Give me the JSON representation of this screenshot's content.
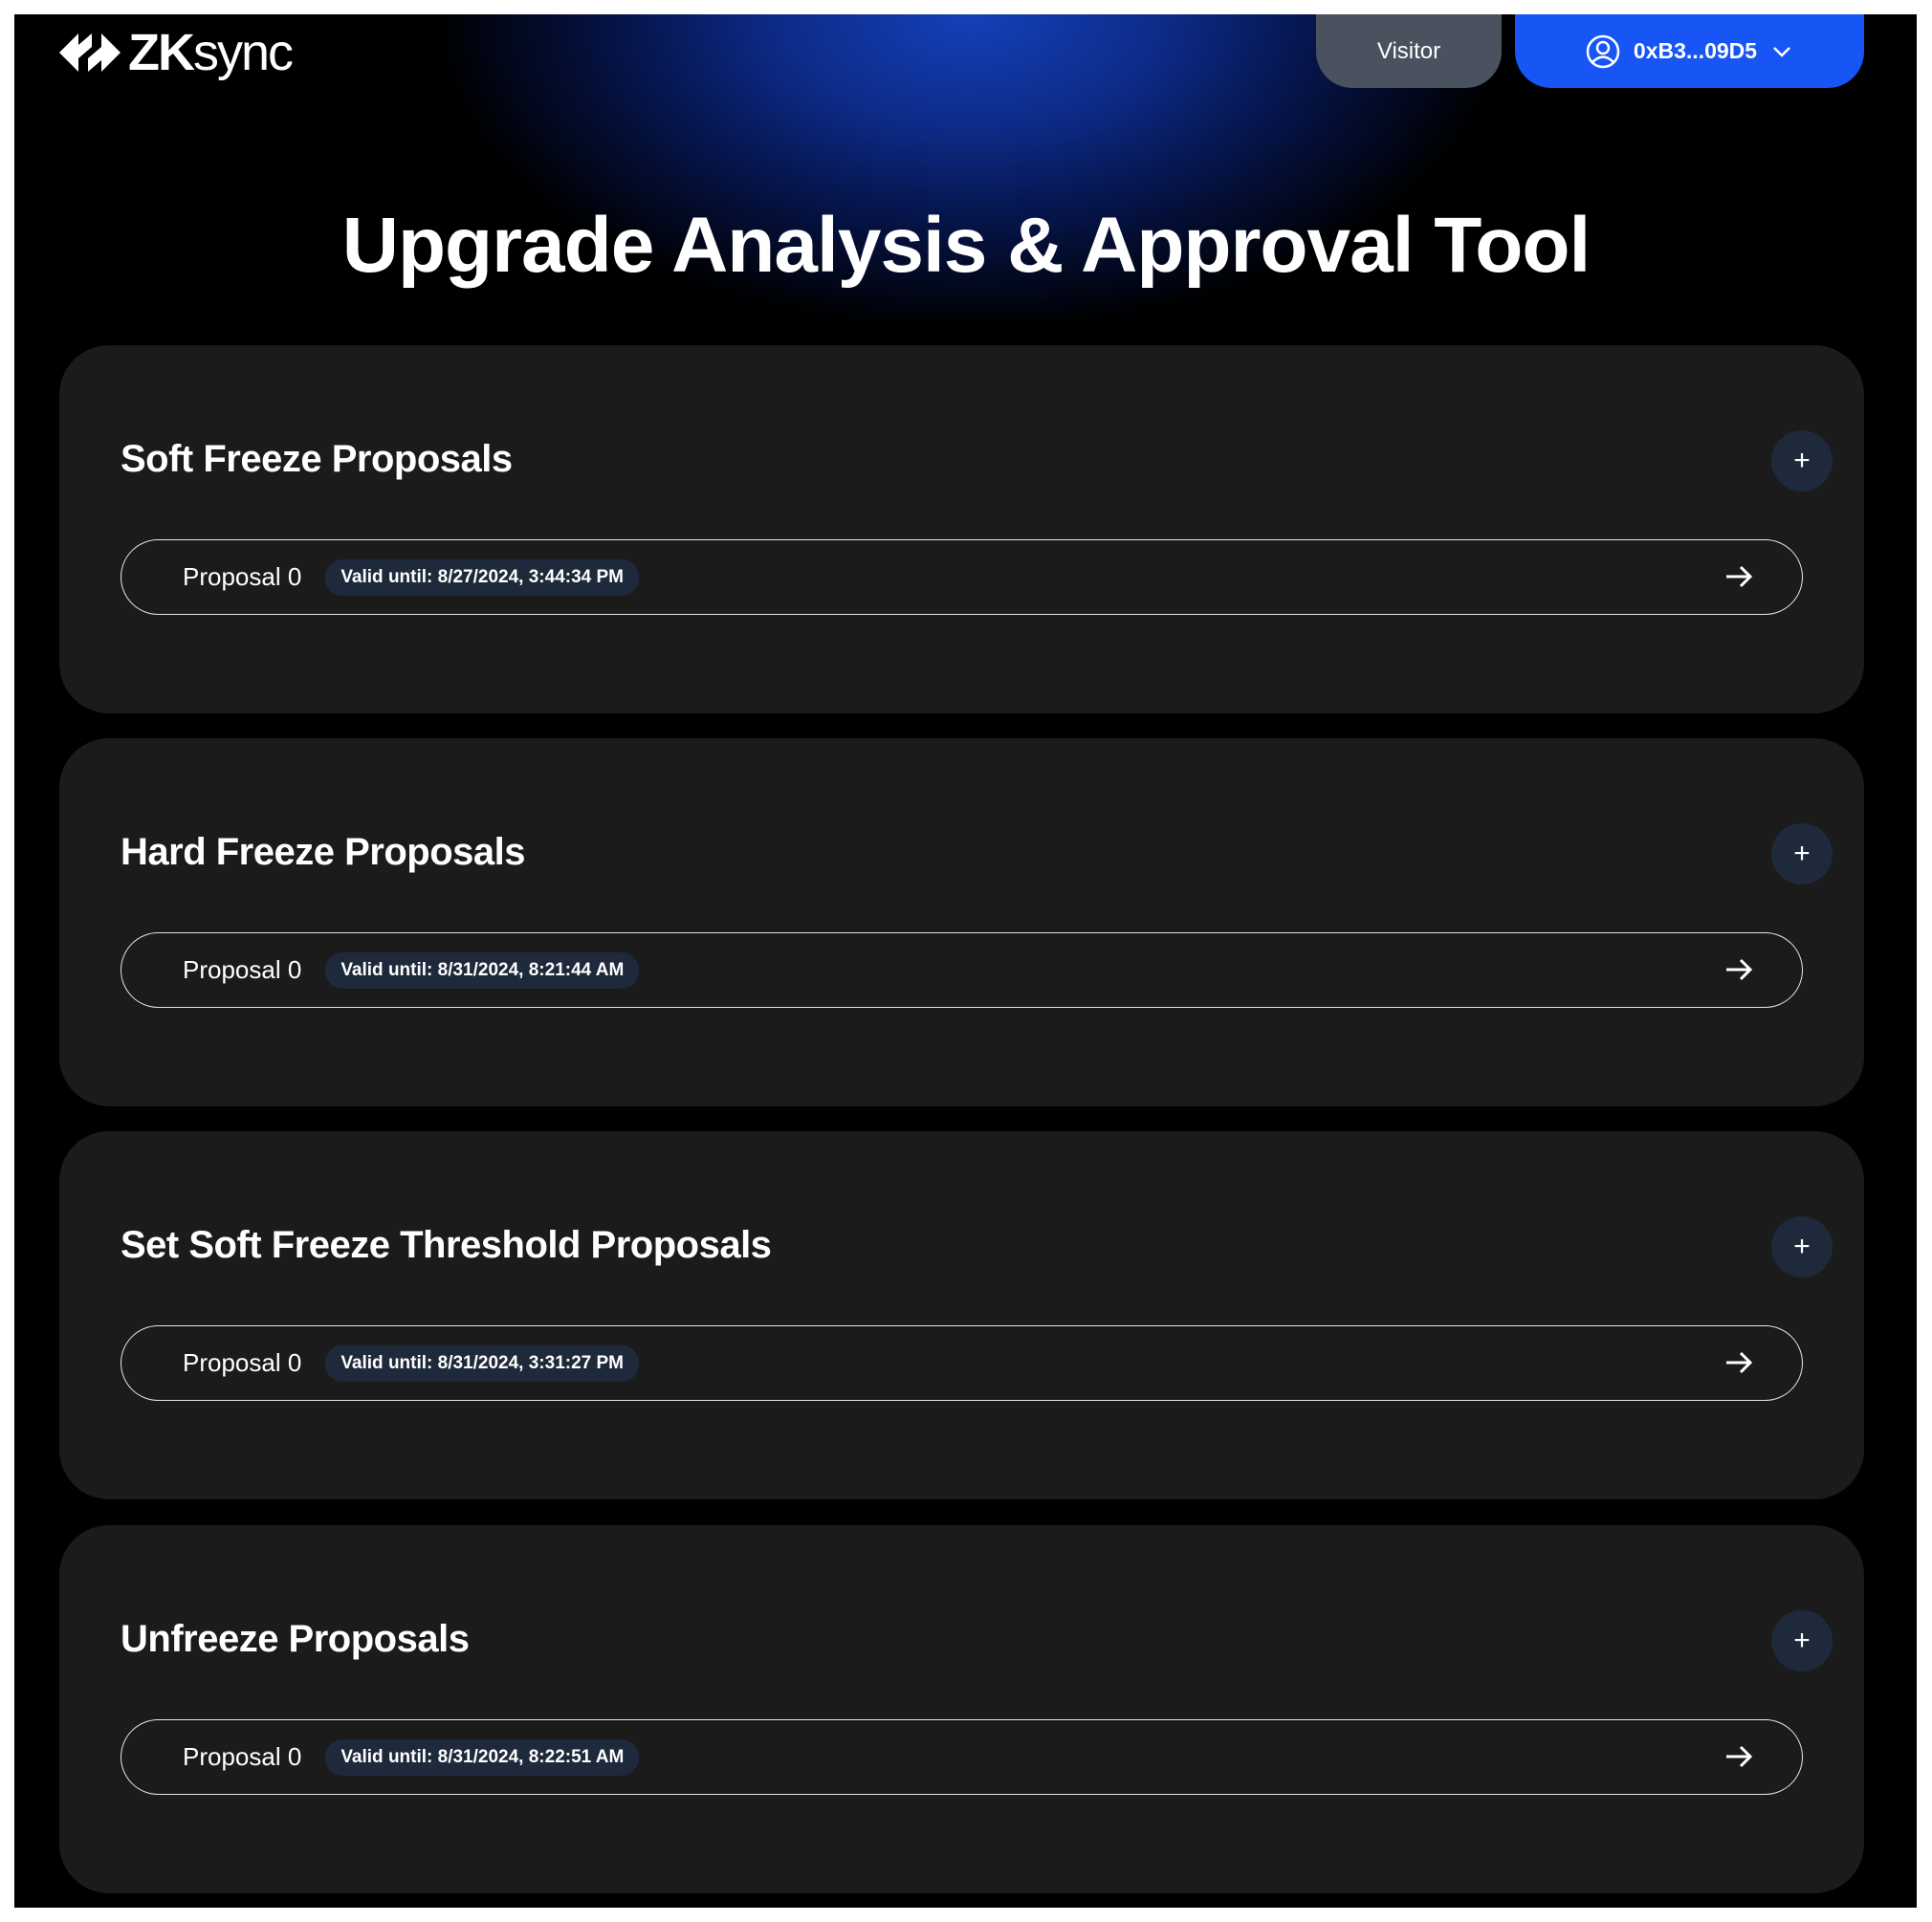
{
  "header": {
    "logo_text_bold": "ZK",
    "logo_text_rest": "sync",
    "visitor_label": "Visitor",
    "wallet_label": "0xB3...09D5",
    "icons": {
      "wallet": "user-circle-icon",
      "dropdown": "chevron-down-icon"
    }
  },
  "page_title": "Upgrade Analysis & Approval Tool",
  "sections": [
    {
      "title": "Soft Freeze Proposals",
      "proposals": [
        {
          "name": "Proposal 0",
          "valid_until": "Valid until: 8/27/2024, 3:44:34 PM"
        }
      ]
    },
    {
      "title": "Hard Freeze Proposals",
      "proposals": [
        {
          "name": "Proposal 0",
          "valid_until": "Valid until: 8/31/2024, 8:21:44 AM"
        }
      ]
    },
    {
      "title": "Set Soft Freeze Threshold Proposals",
      "proposals": [
        {
          "name": "Proposal 0",
          "valid_until": "Valid until: 8/31/2024, 3:31:27 PM"
        }
      ]
    },
    {
      "title": "Unfreeze Proposals",
      "proposals": [
        {
          "name": "Proposal 0",
          "valid_until": "Valid until: 8/31/2024, 8:22:51 AM"
        }
      ]
    }
  ],
  "add_label": "+",
  "colors": {
    "accent": "#1755f4",
    "card": "#1b1b1b",
    "badge": "#1e293b",
    "visitor": "#4a5260"
  }
}
